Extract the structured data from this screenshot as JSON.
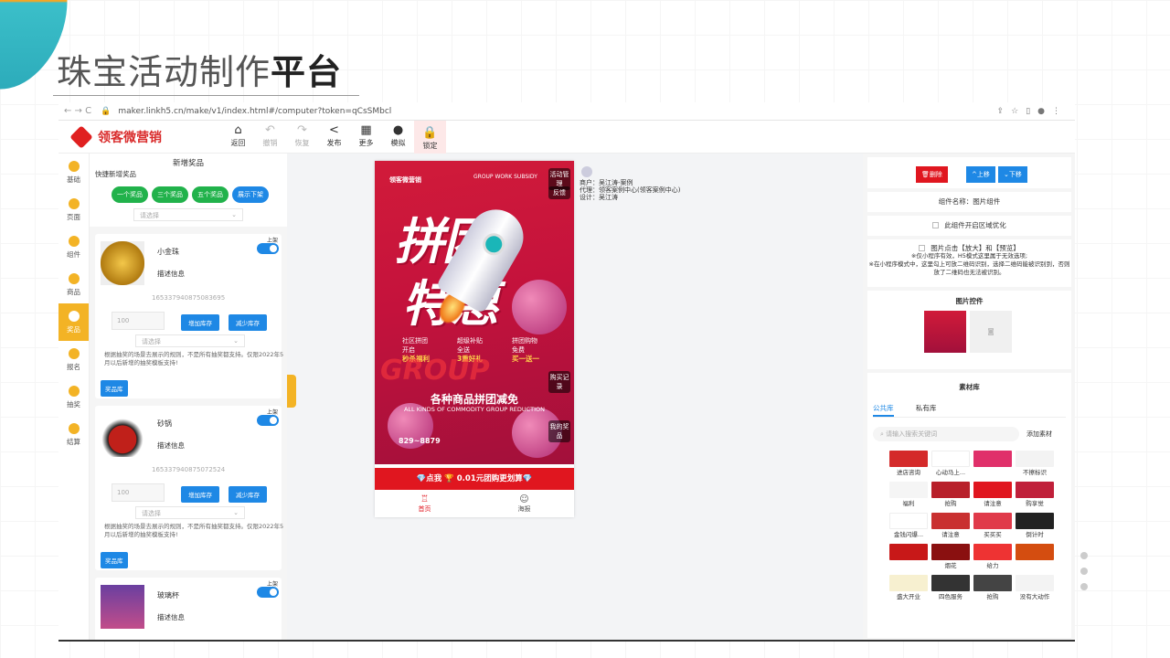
{
  "slide": {
    "title_light": "珠宝活动制作",
    "title_bold": "平台"
  },
  "browser": {
    "url": "maker.linkh5.cn/make/v1/index.html#/computer?token=qCsSMbcl",
    "nav": "← → C"
  },
  "app": {
    "logo": "领客微营销",
    "tools": [
      {
        "label": "返回",
        "icon": "⌂"
      },
      {
        "label": "撤销",
        "icon": "↶"
      },
      {
        "label": "恢复",
        "icon": "↷"
      },
      {
        "label": "发布",
        "icon": "<"
      },
      {
        "label": "更多",
        "icon": "▦"
      },
      {
        "label": "模拟",
        "icon": "●"
      },
      {
        "label": "锁定",
        "icon": "🔒"
      }
    ],
    "sidebar": [
      "基础",
      "页面",
      "组件",
      "商品",
      "奖品",
      "报名",
      "抽奖",
      "结算"
    ],
    "prize_panel": {
      "title": "新增奖品",
      "quick": "快捷新增奖品",
      "quick_buttons": [
        "一个奖品",
        "三个奖品",
        "五个奖品",
        "展示下架"
      ],
      "select_placeholder": "请选择",
      "cards": [
        {
          "name": "小金珠",
          "desc": "描述信息",
          "id": "16533794087508​3695",
          "qty": "100",
          "add": "增加库存",
          "sub": "减少库存",
          "select": "请选择",
          "note": "根据抽奖的场景去展示的规则，不是所有抽奖都支持。仅限2022年5月以后新增的抽奖模板支持!",
          "lib": "奖品库",
          "shelf": "上架"
        },
        {
          "name": "砂锅",
          "desc": "描述信息",
          "id": "16533794087507​2524",
          "qty": "100",
          "add": "增加库存",
          "sub": "减少库存",
          "select": "请选择",
          "note": "根据抽奖的场景去展示的规则，不是所有抽奖都支持。仅限2022年5月以后新增的抽奖模板支持!",
          "lib": "奖品库",
          "shelf": "上架"
        },
        {
          "name": "玻璃杯",
          "desc": "描述信息",
          "shelf": "上架"
        }
      ]
    },
    "poster": {
      "logo": "领客微营销",
      "tag": "GROUP WORK SUBSIDY",
      "big1": "拼团",
      "big2": "特惠",
      "promos": [
        {
          "l1": "社区拼团",
          "l2": "开启",
          "l3": "秒杀福利"
        },
        {
          "l1": "超级补贴",
          "l2": "全送",
          "l3": "3重好礼"
        },
        {
          "l1": "拼团购物",
          "l2": "免费",
          "l3": "买一送一"
        }
      ],
      "ghost": "GROUP",
      "headline": "各种商品拼团减免",
      "sub": "ALL KINDS OF COMMODITY GROUP REDUCTION",
      "phone": "829~8879",
      "side_buttons": [
        "活动管理",
        "反馈",
        "购买记录",
        "我的奖品"
      ],
      "cta": "💎点我 🏆 0.01元团购更划算💎",
      "tabs": [
        "首页",
        "海报"
      ]
    },
    "meta": {
      "merchant": "商户：吴江涛-案例",
      "agent": "代理：领客案例中心(领客案例中心)",
      "design": "设计：吴江涛"
    },
    "right": {
      "delete": "删除",
      "up": "上移",
      "down": "下移",
      "comp_name": "组件名称：图片组件",
      "opt1": "此组件开启区域优化",
      "opt2": "图片点击【放大】和【预览】",
      "notes": [
        "※仅小程序有效，H5模式这里属于无效选项;",
        "※在小程序模式中，这里勾上可放二维码识别，选择二维码能被识别到，否则放了二维码也无法被识别。"
      ],
      "img_ctrl": "图片控件",
      "material": "素材库",
      "tabs": [
        "公共库",
        "私有库"
      ],
      "search": "请输入搜索关键词",
      "add": "添加素材",
      "items": [
        "进店咨询",
        "心动马上...",
        "",
        "不擦标识",
        "福利",
        "抢购",
        "请注意",
        "购享觉",
        "金钱闪爆...",
        "请注意",
        "买买买",
        "倒计时",
        "",
        "烟花",
        "给力",
        "",
        "盛大开业",
        "四色服务",
        "抢购",
        "没有大动作"
      ]
    }
  }
}
